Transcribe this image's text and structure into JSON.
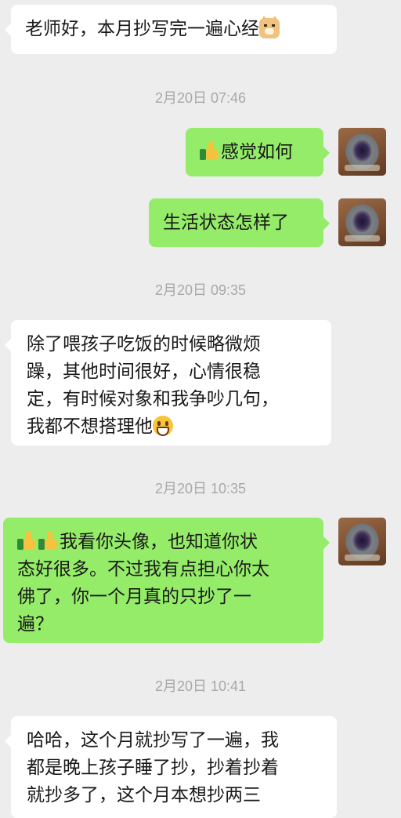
{
  "messages": [
    {
      "type": "in",
      "text": "老师好，本月抄写完一遍心经",
      "emoji": "doge-emoji"
    },
    {
      "type": "time",
      "text": "2月20日 07:46"
    },
    {
      "type": "out",
      "prefix_emoji": "thumbs-up-emoji",
      "text": "感觉如何"
    },
    {
      "type": "out",
      "text": "生活状态怎样了"
    },
    {
      "type": "time",
      "text": "2月20日 09:35"
    },
    {
      "type": "in",
      "text": "除了喂孩子吃饭的时候略微烦\n躁，其他时间很好，心情很稳\n定，有时候对象和我争吵几句，\n我都不想搭理他",
      "emoji": "grin-emoji"
    },
    {
      "type": "time",
      "text": "2月20日 10:35"
    },
    {
      "type": "out",
      "prefix_emoji": "thumbs-up-emoji x2",
      "text": "我看你头像，也知道你状\n态好很多。不过我有点担心你太\n佛了，你一个月真的只抄了一\n遍？"
    },
    {
      "type": "time",
      "text": "2月20日 10:41"
    },
    {
      "type": "in",
      "text": "哈哈，这个月就抄写了一遍，我\n都是晚上孩子睡了抄，抄着抄着\n就抄多了，这个月本想抄两三"
    }
  ],
  "colors": {
    "background": "#ededed",
    "incoming_bubble": "#ffffff",
    "outgoing_bubble": "#95ec69",
    "timestamp": "#a8a8a8"
  }
}
